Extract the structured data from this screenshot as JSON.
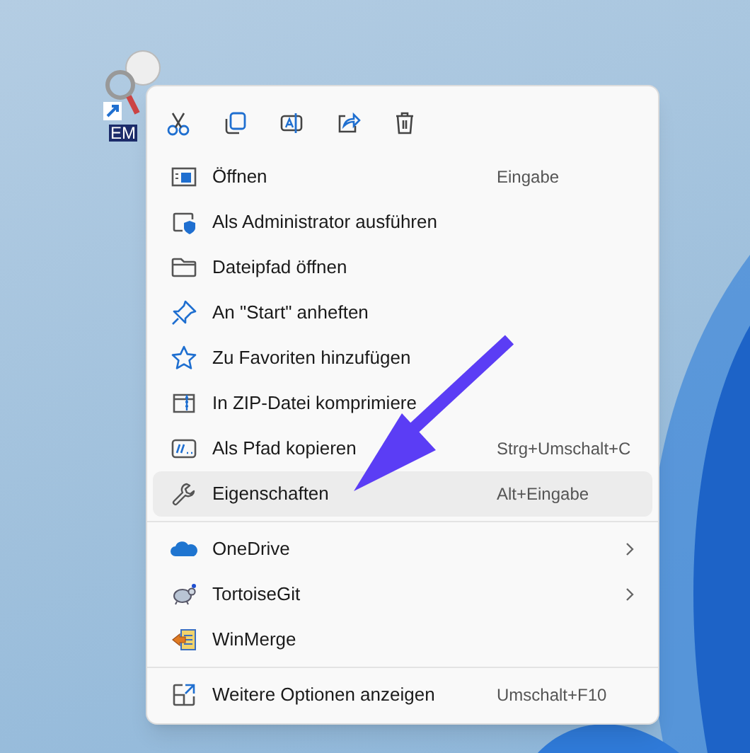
{
  "desktop_icon": {
    "label": "EM"
  },
  "context_menu": {
    "sections": [
      {
        "items": [
          {
            "label": "Öffnen",
            "shortcut": "Eingabe",
            "selected": false
          },
          {
            "label": "Als Administrator ausführen",
            "selected": false
          },
          {
            "label": "Dateipfad öffnen",
            "selected": false
          },
          {
            "label": "An \"Start\" anheften",
            "selected": false
          },
          {
            "label": "Zu Favoriten hinzufügen",
            "selected": false
          },
          {
            "label": "In ZIP-Datei komprimiere",
            "selected": false
          },
          {
            "label": "Als Pfad kopieren",
            "shortcut": "Strg+Umschalt+C",
            "selected": false
          },
          {
            "label": "Eigenschaften",
            "shortcut": "Alt+Eingabe",
            "selected": true
          }
        ]
      },
      {
        "items": [
          {
            "label": "OneDrive",
            "submenu": true,
            "selected": false
          },
          {
            "label": "TortoiseGit",
            "submenu": true,
            "selected": false
          },
          {
            "label": "WinMerge",
            "selected": false
          }
        ]
      },
      {
        "items": [
          {
            "label": "Weitere Optionen anzeigen",
            "shortcut": "Umschalt+F10",
            "selected": false
          }
        ]
      }
    ]
  }
}
